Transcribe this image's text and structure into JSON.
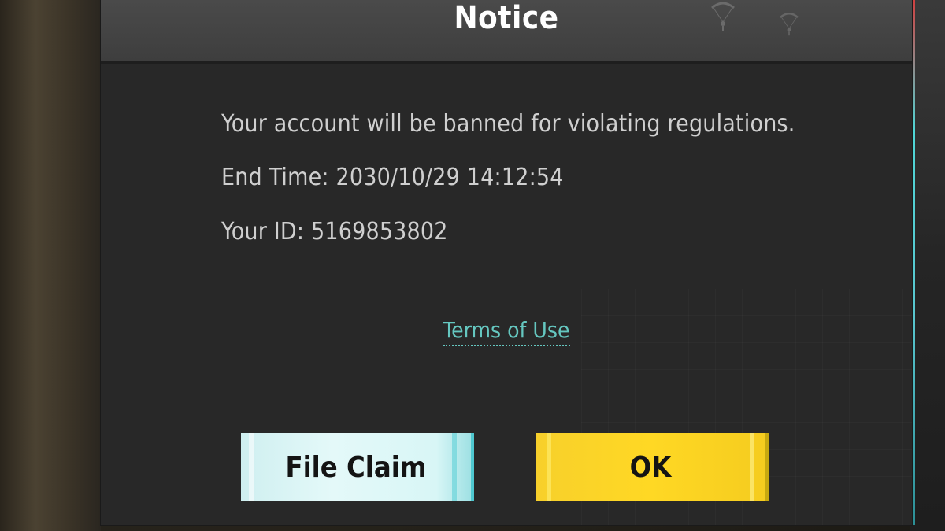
{
  "dialog": {
    "title": "Notice",
    "message": "Your account will be banned for violating regulations.",
    "end_time": "End Time: 2030/10/29 14:12:54",
    "user_id": "Your ID: 5169853802",
    "terms_link": "Terms of Use"
  },
  "buttons": {
    "file_claim": "File Claim",
    "ok": "OK"
  },
  "colors": {
    "dialog_bg": "#282828",
    "header_bg": "#4a4a4a",
    "text": "#cfcfcf",
    "link": "#65c7c0",
    "ok_button": "#ffd824",
    "claim_button": "#e4f9f9"
  },
  "icons": {
    "header_decoration": "paratrooper-icon"
  }
}
